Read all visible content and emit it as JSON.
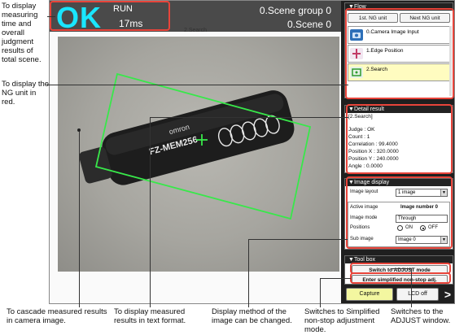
{
  "annotations": {
    "top_left": "To display measuring time and overall judgment results of total scene.",
    "ng_unit": "To display the NG unit in red.",
    "cascade": "To cascade measured results in camera image.",
    "text_format": "To display measured results in text format.",
    "display_method": "Display method of the image can be changed.",
    "simplified": "Switches to Simplified non-stop adjustment mode.",
    "adjust": "Switches to the ADJUST window."
  },
  "status": {
    "judgment": "OK",
    "mode": "RUN",
    "time": "17ms",
    "scene_group": "0.Scene group 0",
    "scene": "0.Scene 0"
  },
  "image": {
    "title": "2.Search",
    "device_label": "FZ-MEM256",
    "brand": "omron"
  },
  "flow": {
    "header": "Flow",
    "btn_first_ng": "1st. NG unit",
    "btn_next_ng": "Next NG unit",
    "items": [
      {
        "label": "0.Camera Image Input",
        "icon": "camera-icon"
      },
      {
        "label": "1.Edge Position",
        "icon": "edge-position-icon"
      },
      {
        "label": "2.Search",
        "icon": "search-icon"
      }
    ]
  },
  "detail": {
    "header": "Detail result",
    "lines": [
      "[2.Search]",
      "",
      "Judge : OK",
      "Count : 1",
      "Correlation : 99.4000",
      "Position X : 320.0000",
      "Position Y : 240.0000",
      "Angle : 0.0000"
    ]
  },
  "image_display": {
    "header": "Image display",
    "layout_label": "Image layout",
    "layout_value": "1 image",
    "active_label": "Active image",
    "active_value": "Image number 0",
    "mode_label": "Image mode",
    "mode_value": "Through",
    "positions_label": "Positions",
    "on_label": "ON",
    "off_label": "OFF",
    "sub_label": "Sub image",
    "sub_value": "Image 0"
  },
  "toolbox": {
    "header": "Tool box",
    "adjust_btn": "Switch to ADJUST mode",
    "simplified_btn": "Enter simplified non-stop adj.",
    "capture_btn": "Capture",
    "lcd_btn": "LCD off",
    "next_arrow": ">"
  },
  "colors": {
    "ok": "#19e6ff",
    "highlight": "#e8443a",
    "match_box": "#38e84a",
    "selected_flow": "#fffcc0",
    "capture_btn": "#f3f7a0"
  }
}
